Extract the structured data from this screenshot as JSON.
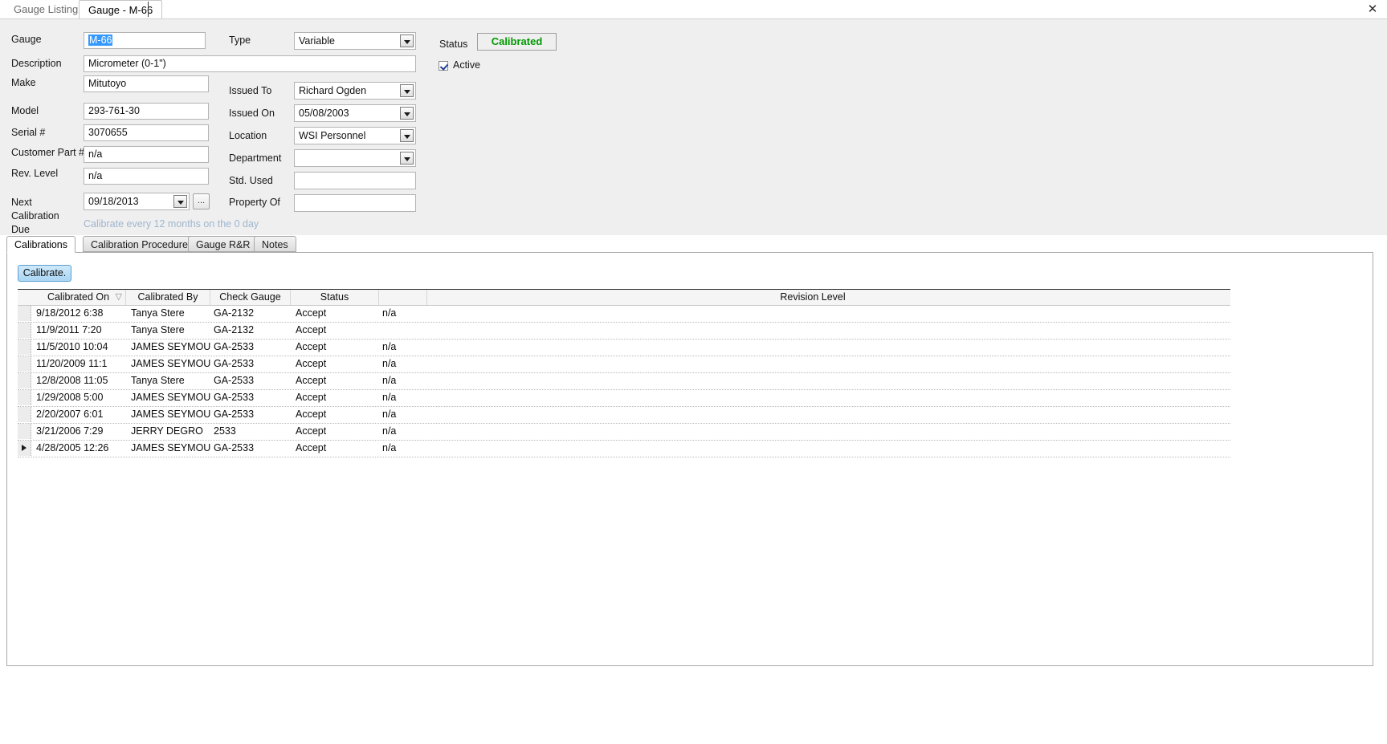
{
  "window": {
    "close_label": "✕"
  },
  "tabs": [
    {
      "label": "Gauge Listing",
      "active": false
    },
    {
      "label": "Gauge - M-66",
      "active": true
    }
  ],
  "form": {
    "labels": {
      "gauge": "Gauge",
      "description": "Description",
      "make": "Make",
      "model": "Model",
      "serial": "Serial #",
      "customer_part": "Customer Part #",
      "rev_level": "Rev. Level",
      "next_calibration_due_l1": "Next",
      "next_calibration_due_l2": "Calibration",
      "next_calibration_due_l3": "Due",
      "type": "Type",
      "issued_to": "Issued To",
      "issued_on": "Issued On",
      "location": "Location",
      "department": "Department",
      "std_used": "Std. Used",
      "property_of": "Property Of",
      "status": "Status",
      "active": "Active"
    },
    "values": {
      "gauge": "M-66",
      "description": "Micrometer (0-1\")",
      "make": "Mitutoyo",
      "model": "293-761-30",
      "serial": "3070655",
      "customer_part": "n/a",
      "rev_level": "n/a",
      "next_calibration_due": "09/18/2013",
      "type": "Variable",
      "issued_to": "Richard Ogden",
      "issued_on": "05/08/2003",
      "location": "WSI Personnel",
      "department": "",
      "std_used": "",
      "property_of": "",
      "status": "Calibrated"
    },
    "browse_button_label": "...",
    "calibration_note": "Calibrate every 12 months on the 0 day",
    "status_color": "#009900",
    "note_color": "#9fb6cf",
    "selection_color": "#3399ff"
  },
  "inner_tabs": [
    {
      "label": "Calibrations",
      "selected": true
    },
    {
      "label": "Calibration Procedure",
      "selected": false
    },
    {
      "label": "Gauge R&R",
      "selected": false
    },
    {
      "label": "Notes",
      "selected": false
    }
  ],
  "calibrate_button": {
    "label": "Calibrate."
  },
  "grid": {
    "columns": [
      {
        "label": "Calibrated On",
        "sorted": true,
        "sort_dir": "desc"
      },
      {
        "label": "Calibrated By"
      },
      {
        "label": "Check Gauge"
      },
      {
        "label": "Status"
      },
      {
        "label": ""
      },
      {
        "label": "Revision Level"
      }
    ],
    "rows": [
      {
        "calibrated_on": "9/18/2012 6:38",
        "calibrated_by": "Tanya Stere",
        "check_gauge": "GA-2132",
        "status": "Accept",
        "blank": "n/a",
        "revision_level": "",
        "current": false
      },
      {
        "calibrated_on": "11/9/2011 7:20",
        "calibrated_by": "Tanya Stere",
        "check_gauge": "GA-2132",
        "status": "Accept",
        "blank": "",
        "revision_level": "",
        "current": false
      },
      {
        "calibrated_on": "11/5/2010 10:04",
        "calibrated_by": "JAMES SEYMOU",
        "check_gauge": "GA-2533",
        "status": "Accept",
        "blank": "n/a",
        "revision_level": "",
        "current": false
      },
      {
        "calibrated_on": "11/20/2009 11:1",
        "calibrated_by": "JAMES SEYMOU",
        "check_gauge": "GA-2533",
        "status": "Accept",
        "blank": "n/a",
        "revision_level": "",
        "current": false
      },
      {
        "calibrated_on": "12/8/2008 11:05",
        "calibrated_by": "Tanya Stere",
        "check_gauge": "GA-2533",
        "status": "Accept",
        "blank": "n/a",
        "revision_level": "",
        "current": false
      },
      {
        "calibrated_on": "1/29/2008 5:00",
        "calibrated_by": "JAMES SEYMOU",
        "check_gauge": "GA-2533",
        "status": "Accept",
        "blank": "n/a",
        "revision_level": "",
        "current": false
      },
      {
        "calibrated_on": "2/20/2007 6:01",
        "calibrated_by": "JAMES SEYMOU",
        "check_gauge": "GA-2533",
        "status": "Accept",
        "blank": "n/a",
        "revision_level": "",
        "current": false
      },
      {
        "calibrated_on": "3/21/2006 7:29",
        "calibrated_by": "JERRY DEGRO",
        "check_gauge": "2533",
        "status": "Accept",
        "blank": "n/a",
        "revision_level": "",
        "current": false
      },
      {
        "calibrated_on": "4/28/2005 12:26",
        "calibrated_by": "JAMES SEYMOU",
        "check_gauge": "GA-2533",
        "status": "Accept",
        "blank": "n/a",
        "revision_level": "",
        "current": true
      }
    ]
  }
}
